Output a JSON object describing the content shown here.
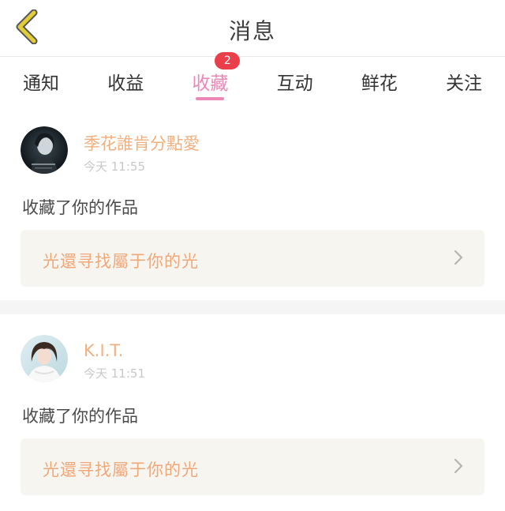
{
  "header": {
    "title": "消息",
    "back_icon": "chevron-left-icon",
    "back_color": "#e2cd39"
  },
  "tabs": [
    {
      "label": "通知",
      "active": false
    },
    {
      "label": "收益",
      "active": false
    },
    {
      "label": "收藏",
      "active": true,
      "badge": "2"
    },
    {
      "label": "互动",
      "active": false
    },
    {
      "label": "鲜花",
      "active": false
    },
    {
      "label": "关注",
      "active": false
    }
  ],
  "colors": {
    "active_tab": "#e889b7",
    "badge": "#ea3e4a",
    "username": "#f0b080",
    "work_title": "#f0a878"
  },
  "messages": [
    {
      "username": "季花誰肯分點愛",
      "time": "今天 11:55",
      "action": "收藏了你的作品",
      "work_title": "光還寻找屬于你的光"
    },
    {
      "username": "K.I.T.",
      "time": "今天 11:51",
      "action": "收藏了你的作品",
      "work_title": "光還寻找屬于你的光"
    }
  ]
}
